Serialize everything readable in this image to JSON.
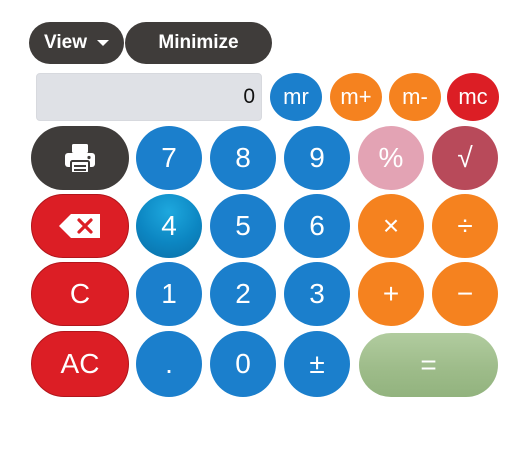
{
  "toolbar": {
    "view_label": "View",
    "minimize_label": "Minimize"
  },
  "display": {
    "value": "0"
  },
  "memory": {
    "recall": "mr",
    "add": "m+",
    "subtract": "m-",
    "clear": "mc"
  },
  "keys": {
    "seven": "7",
    "eight": "8",
    "nine": "9",
    "four": "4",
    "five": "5",
    "six": "6",
    "one": "1",
    "two": "2",
    "three": "3",
    "decimal": ".",
    "zero": "0",
    "plus_minus": "±",
    "percent": "%",
    "sqrt": "√",
    "multiply": "×",
    "divide": "÷",
    "add": "+",
    "subtract": "−",
    "clear": "C",
    "all_clear": "AC",
    "equals": "="
  },
  "icons": {
    "print": "printer-icon",
    "backspace": "backspace-icon"
  },
  "colors": {
    "digit_blue": "#1b7fcc",
    "operator_orange": "#f5821f",
    "clear_red": "#dc1e25",
    "dark_gray": "#3f3c3a",
    "percent_pink": "#e3a3b4",
    "sqrt_rose": "#b84a5a",
    "equals_green": "#9ebc8a"
  }
}
